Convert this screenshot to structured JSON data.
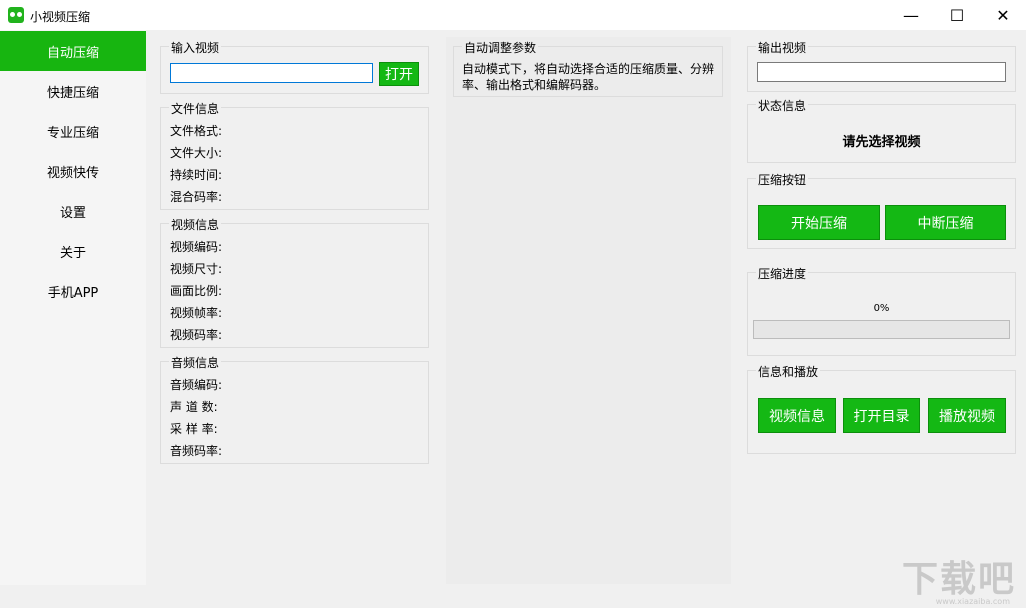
{
  "window": {
    "title": "小视频压缩",
    "minimize": "—",
    "maximize": "☐",
    "close": "✕"
  },
  "sidebar": {
    "items": [
      {
        "label": "自动压缩",
        "active": true
      },
      {
        "label": "快捷压缩"
      },
      {
        "label": "专业压缩"
      },
      {
        "label": "视频快传"
      },
      {
        "label": "设置"
      },
      {
        "label": "关于"
      },
      {
        "label": "手机APP"
      }
    ]
  },
  "input_video": {
    "title": "输入视频",
    "value": "",
    "open_label": "打开"
  },
  "file_info": {
    "title": "文件信息",
    "fields": [
      "文件格式:",
      "文件大小:",
      "持续时间:",
      "混合码率:"
    ]
  },
  "video_info": {
    "title": "视频信息",
    "fields": [
      "视频编码:",
      "视频尺寸:",
      "画面比例:",
      "视频帧率:",
      "视频码率:"
    ]
  },
  "audio_info": {
    "title": "音频信息",
    "fields": [
      "音频编码:",
      "声 道 数:",
      "采 样 率:",
      "音频码率:"
    ]
  },
  "auto_params": {
    "title": "自动调整参数",
    "desc": "自动模式下，将自动选择合适的压缩质量、分辨率、输出格式和编解码器。"
  },
  "output_video": {
    "title": "输出视频",
    "value": ""
  },
  "status": {
    "title": "状态信息",
    "text": "请先选择视频"
  },
  "compress_buttons": {
    "title": "压缩按钮",
    "start": "开始压缩",
    "stop": "中断压缩"
  },
  "progress": {
    "title": "压缩进度",
    "text": "0%",
    "value": 0
  },
  "info_play": {
    "title": "信息和播放",
    "video_info": "视频信息",
    "open_dir": "打开目录",
    "play": "播放视频"
  },
  "watermark": {
    "text": "下载吧",
    "sub": "www.xiazaiba.com"
  },
  "colors": {
    "accent": "#17b510",
    "background": "#f0f0f0"
  }
}
